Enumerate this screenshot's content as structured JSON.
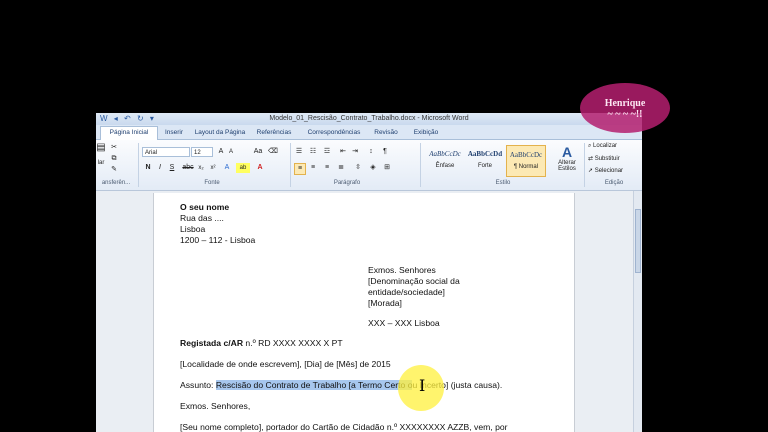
{
  "window": {
    "title": "Modelo_01_Rescisão_Contrato_Trabalho.docx - Microsoft Word",
    "qat": "W ◂ ↶ ↻ ▾"
  },
  "tabs": [
    "Página Inicial",
    "Inserir",
    "Layout da Página",
    "Referências",
    "Correspondências",
    "Revisão",
    "Exibição"
  ],
  "ribbon": {
    "clipboard_label": "ansferên...",
    "clipboard_tool": "lar",
    "font_name": "Arial",
    "font_size": "12",
    "font_group_label": "Fonte",
    "paragraph_group_label": "Parágrafo",
    "styles_group_label": "Estilo",
    "edit_group_label": "Edição",
    "styles": [
      {
        "preview": "AaBbCcDc",
        "name": "Ênfase"
      },
      {
        "preview": "AaBbCcDd",
        "name": "Forte"
      },
      {
        "preview": "AaBbCcDc",
        "name": "¶ Normal"
      }
    ],
    "change_styles": "Alterar Estilos",
    "find": "Localizar",
    "replace": "Substituir",
    "select": "Selecionar"
  },
  "letter": {
    "sender_name": "O seu nome",
    "sender_street": "Rua das ....",
    "sender_city": "Lisboa",
    "sender_postal": "1200 – 112 - Lisboa",
    "recipient_1": "Exmos. Senhores",
    "recipient_2": "[Denominação social da",
    "recipient_3": "entidade/sociedade]",
    "recipient_4": "[Morada]",
    "recipient_postal": "XXX – XXX Lisboa",
    "registered_bold": "Registada c/AR",
    "registered_rest": " n.º RD XXXX XXXX X PT",
    "place_date": "[Localidade de onde escrevem], [Dia] de [Mês] de 2015",
    "subject_label": "Assunto: ",
    "subject_selected": "Rescisão do Contrato de Trabalho [a Termo Certo o",
    "subject_rest": "u Incerto] (justa causa).",
    "salutation": "Exmos. Senhores,",
    "body_start": "[Seu nome completo], portador do Cartão de Cidadão n.º XXXXXXXX AZZB, vem, por"
  },
  "watermark": {
    "line1": "Henrique",
    "line2": "~ ~ ~ ~!!"
  }
}
